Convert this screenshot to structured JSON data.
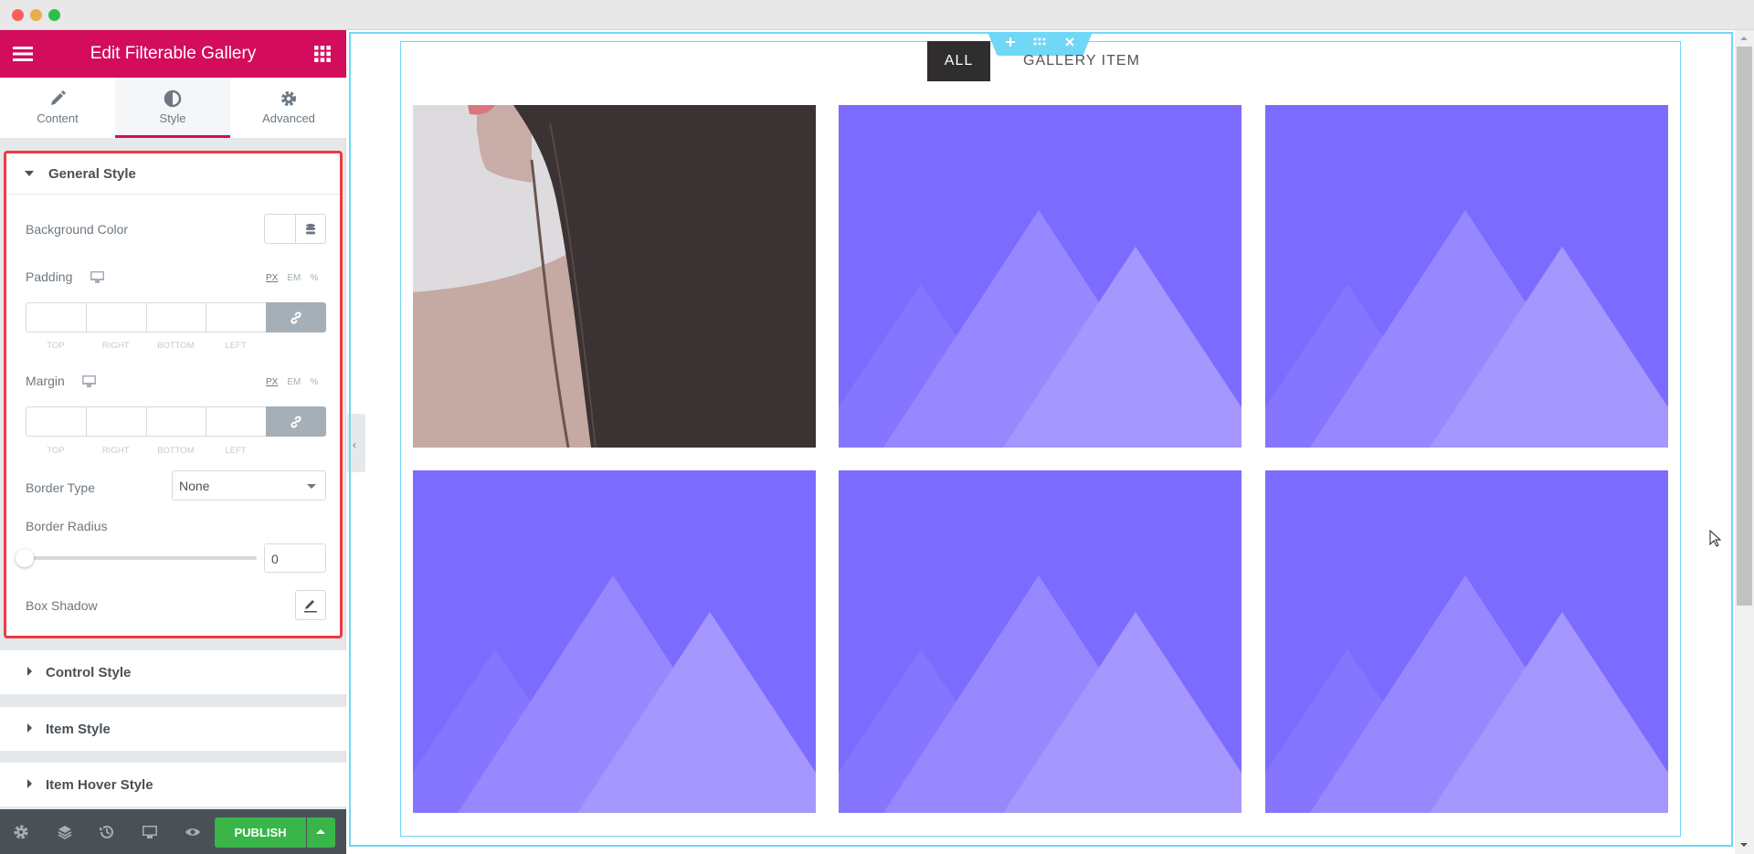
{
  "window": {
    "controls": [
      "close",
      "minimize",
      "maximize"
    ]
  },
  "sidebar": {
    "header": {
      "title": "Edit Filterable Gallery",
      "menu_icon": "hamburger-icon",
      "apps_icon": "grid-icon"
    },
    "tabs": [
      {
        "label": "Content",
        "icon": "pencil-icon"
      },
      {
        "label": "Style",
        "icon": "contrast-icon",
        "active": true
      },
      {
        "label": "Advanced",
        "icon": "gear-icon"
      }
    ],
    "general_style": {
      "title": "General Style",
      "background_color": {
        "label": "Background Color"
      },
      "padding": {
        "label": "Padding",
        "units": [
          "PX",
          "EM",
          "%"
        ],
        "active_unit": "PX",
        "fields": [
          "TOP",
          "RIGHT",
          "BOTTOM",
          "LEFT"
        ],
        "values": [
          "",
          "",
          "",
          ""
        ]
      },
      "margin": {
        "label": "Margin",
        "units": [
          "PX",
          "EM",
          "%"
        ],
        "active_unit": "PX",
        "fields": [
          "TOP",
          "RIGHT",
          "BOTTOM",
          "LEFT"
        ],
        "values": [
          "",
          "",
          "",
          ""
        ]
      },
      "border_type": {
        "label": "Border Type",
        "value": "None"
      },
      "border_radius": {
        "label": "Border Radius",
        "value": "0",
        "slider_fraction": 0
      },
      "box_shadow": {
        "label": "Box Shadow"
      }
    },
    "sections": [
      "Control Style",
      "Item Style",
      "Item Hover Style"
    ],
    "footer": {
      "publish": "PUBLISH",
      "icons": [
        "gear-icon",
        "layers-icon",
        "history-icon",
        "desktop-icon",
        "eye-icon"
      ]
    }
  },
  "canvas": {
    "filters": [
      {
        "label": "ALL",
        "active": true
      },
      {
        "label": "GALLERY ITEM",
        "active": false
      }
    ],
    "gallery": [
      "photo",
      "placeholder",
      "placeholder",
      "placeholder",
      "placeholder",
      "placeholder"
    ]
  },
  "colors": {
    "brand": "#d30c5c",
    "highlight": "#ef3a3f",
    "publish": "#39b54a",
    "placeholder_bg": "#7b6bff",
    "editor_outline": "#71d7f7"
  }
}
